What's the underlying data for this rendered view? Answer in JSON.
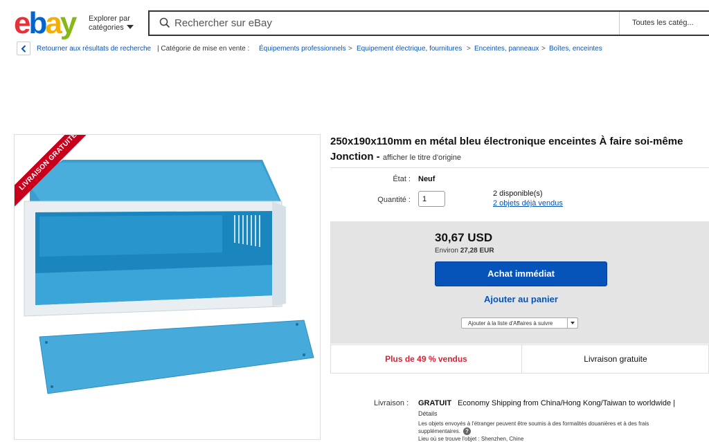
{
  "header": {
    "logo_text": "ebay",
    "shop_by": [
      "Explorer par",
      "catégories"
    ],
    "search_placeholder": "Rechercher sur eBay",
    "search_category": "Toutes les catég..."
  },
  "breadcrumb": {
    "back_label": "Retourner aux résultats de recherche",
    "listed_in": "| Catégorie de mise en vente :",
    "items": [
      "Équipements professionnels",
      "Equipement électrique, fournitures",
      "Enceintes, panneaux",
      "Boîtes, enceintes"
    ],
    "separator": ">"
  },
  "image": {
    "ribbon": "LIVRAISON GRATUITE"
  },
  "product": {
    "title": "250x190x110mm en métal bleu électronique enceintes À faire soi-même Jonction -",
    "orig_title_link": "afficher le titre d'origine",
    "condition_label": "État :",
    "condition": "Neuf",
    "quantity_label": "Quantité :",
    "quantity": "1",
    "available": "2 disponible(s)",
    "sold": "2 objets déjà vendus"
  },
  "buy": {
    "price": "30,67 USD",
    "approx_prefix": "Environ",
    "approx_value": "27,28 EUR",
    "buy_now": "Achat immédiat",
    "add_cart": "Ajouter au panier",
    "watch": "Ajouter à la liste d'Affaires à suivre"
  },
  "stats": {
    "sold_pct": "Plus de 49 % vendus",
    "free_ship": "Livraison gratuite"
  },
  "shipping": {
    "label": "Livraison :",
    "free": "GRATUIT",
    "desc": "Economy Shipping from China/Hong Kong/Taiwan to worldwide |",
    "details": "Détails",
    "note": "Les objets envoyés à l'étranger peuvent être soumis à des formalités douanières et à des frais supplémentaires.",
    "location": "Lieu où se trouve l'objet : Shenzhen, Chine"
  },
  "colors": {
    "brand_blue": "#0654ba",
    "sold_red": "#dd1e31",
    "ribbon_red": "#c9001c"
  }
}
